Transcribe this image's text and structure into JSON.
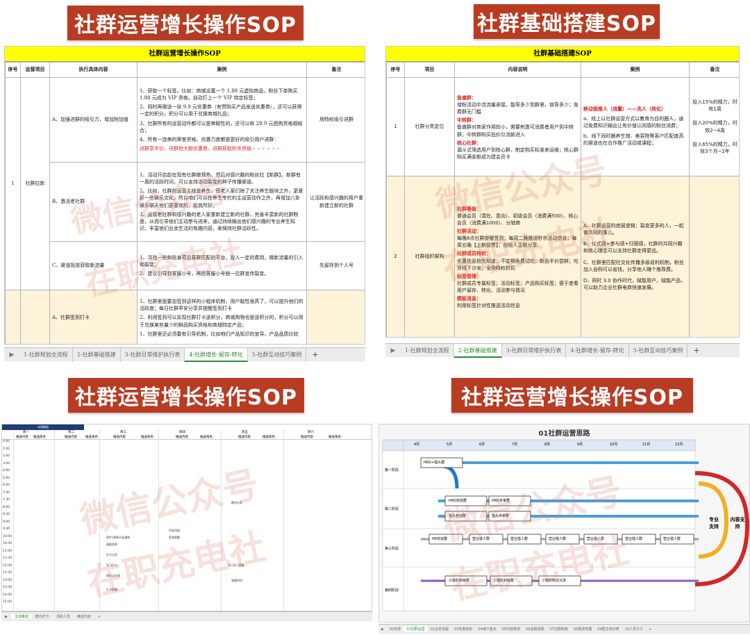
{
  "q1": {
    "banner": "社群运营增长操作SOP",
    "sheet_title": "社群运营增长操作SOP",
    "headers": [
      "序号",
      "运营项目",
      "执行具体内容",
      "案例",
      "备注"
    ],
    "seq": "1",
    "project": "社群拉新",
    "rows": [
      {
        "content": "A、加强进群的吸引力，增加附加值",
        "cases": [
          "1、获取一个标签。比如：商城设置一个 1.88 元虚拟商品，粉丝下单购买1.88 元成为 VIP 资格，自动打上一个 VIP 特定标签；",
          "2、同时再赠送一张 9.9 元优惠券（有赞购买产品发送优惠券），还可以获得一定的积分，积分可以用于兑换商城礼品；",
          "3、社群所有的运营动作都可以是串联性的，还可以和 29.9 元团购资格相结合；",
          "4、所有一连串的荣誉资格、优惠力度都是更好的吸引用户进群："
        ],
        "warn": "进群享半价、进群抢大额优惠券、进群获取秒杀资格・・・・・・",
        "note": "用特权吸引进群"
      },
      {
        "content": "B、激活老社群",
        "cases": [
          "1、活动开启前在现有社群做预热，然后对感兴趣的粉丝拉【新群】，新群有一周的活跃时间，可以支持活动裂变的种子传播渠道。",
          "2、比如，社群的运营主线是养生，而老人家们除了关注养生版块之外，更爱好一些娱乐文化，所以咱们可以在养生专栏的主运营动作之外，再增加八卦娱乐聊天他们更喜欢的，投其所好。",
          "3、运营老社群和感兴趣的老人家重新建立新的社群，完善丰富新的社群制度，从而引导他们主动参与进来，通过持续输出他们感兴趣的专业养生知识、丰富他们业余生活的有趣内容，来保持社群活跃性。"
        ],
        "note": "让活跃和感兴趣的用户重新建立新的社群"
      },
      {
        "content": "C、渠道投放获取新流量",
        "cases": [
          "1、寻找一些和自身项目客群匹配的平台，投入一定的费用，做新流量的引入和裂变；",
          "2、建议引导到客服小号，再由客服小号统一拉群宣传裂变。"
        ],
        "note": "先留存到个人号"
      },
      {
        "content": "A、社群签到打卡",
        "cases": [
          "1、社群里面要加签到这样的小程序机制，用户黏性很高了，可以提升他们的活跃度；每日社群早安分享并提醒签到打卡",
          "2、利用签到可以实现社群打卡送积分，商城购物也是送积分的，积分可以用于兑换某些量少的鲜品购买资格和商城特定产品；",
          "1、社群里还必须要有引导机制，比如咱们产品知识的宣导、产品品质比较"
        ]
      }
    ],
    "tabs": [
      "1-社群规划全流程",
      "2-社群基础搭建",
      "3-社群日常维护执行表",
      "4-社群增长-留存-转化",
      "5-社群互动技巧案例"
    ],
    "active_tab": "4-社群增长-留存-转化"
  },
  "q2": {
    "banner": "社群基础搭建SOP",
    "sheet_title": "社群基础搭建SOP",
    "headers": [
      "序号",
      "项目",
      "内容说明",
      "案例",
      "备注"
    ],
    "row1": {
      "seq": "1",
      "project": "社群分类定位",
      "items": [
        {
          "label": "鱼塘群：",
          "text": "增粉活动中流流量承接，能导多少到群里，就导多少；免费群无门槛"
        },
        {
          "label": "中转群：",
          "text": "鱼塘群对商家作用较小，需要刺激可消费者用户到中转群；中转群购买低价引流款进入"
        },
        {
          "label": "核心社群：",
          "text": "漏斗式筛选用户到核心群，制定购买标准来运维；核心群购买满金额成为建会员卡"
        }
      ],
      "case_title": "移动锁推人（流量）——洗人（转化）",
      "cases": [
        "a、线上以社群运营方式以教育为目的圈人，通过免费知识输出让有价值认同感的粉丝消费；",
        "b、线下同时跟养生馆、美容院等客户匹配度高的渠道也在合作推广活动或课程；"
      ],
      "notes": [
        "投入15%的精力，时效1周",
        "投入20%的精力，时效2~4周",
        "投入65%的精力，时效3个月~2年"
      ]
    },
    "row2": {
      "seq": "2",
      "project": "社群组织架构",
      "items": [
        {
          "label": "社群等级：",
          "text": "普通会员（潜在、意向）、初级会员（消费满500）、核心会员（消费满1000）、分销商"
        },
        {
          "label": "社群活动：",
          "text": "每晚8点社群提醒签到；每周二晚推送秒杀活动信息；每周五晚【上新投票】；创始人主题分享"
        },
        {
          "label": "社群成员特权：",
          "text": "优惠信息抢先知道；不定期免费试吃；新品半价尝鲜；吃货线下沙龙；全场特权折扣"
        },
        {
          "label": "标签管理：",
          "text": "社群成员专属标签；活动标签；产品购买标签；便于查看用户留存、转化、活动参与情况"
        },
        {
          "label": "模板消息：",
          "text": "利用标签针对性推送活动信息"
        }
      ],
      "cases": [
        "A、社群运营的底层逻辑：裂变更多的人，一起做共同的事儿。",
        "B、仪式感+参与感+归宿感，社群的共同兴趣和核心理念可以支持社群走得更远。",
        "C、社群里匹配社交化传播多级返利机制，粉丝加入自购可以省钱，分享他人赚个推荐费。",
        "D、同时 3.0 协作时代，赋能用户，赋能产品，可以助力企业社群电商快速发展。"
      ]
    },
    "tabs": [
      "1-社群规划全流程",
      "2-社群基础搭建",
      "3-社群日常维护执行表",
      "4-社群增长-留存-转化",
      "5-社群互动技巧案例"
    ],
    "active_tab": "2-社群基础搭建"
  },
  "q3": {
    "banner": "社群运营增长操作SOP",
    "header": "本周精选",
    "days": [
      "周一",
      "周二",
      "周三",
      "周四",
      "周五",
      "周六"
    ],
    "col_heads": [
      "推送内容",
      "推送角色"
    ],
    "times": [
      "0:00",
      "1:00",
      "2:00",
      "3:00",
      "4:00",
      "5:00",
      "6:00",
      "7:00",
      "7:30",
      "8:00",
      "8:30",
      "9:00",
      "9:30",
      "10:00",
      "10:30",
      "11:00",
      "11:30",
      "12:00",
      "12:30",
      "13:00",
      "13:30",
      "14:00",
      "15:00"
    ],
    "entries": [
      "DAY1预热开始通知",
      "鼓励签到",
      "早安问候",
      "签到提醒",
      "打卡分享",
      "学习打卡",
      "知识点分享",
      "打卡提醒",
      "今日学习提醒",
      "晚间分享",
      "答疑时间"
    ],
    "tabs": [
      "主动推送",
      "群内打卡",
      "活跃人员",
      "推送内容"
    ],
    "active_tab": "主动推送"
  },
  "q4": {
    "banner": "社群运营增长操作SOP",
    "diagram_title": "01社群运营思路",
    "months": [
      "4月",
      "5月",
      "6月",
      "7月",
      "8月",
      "9月",
      "10月",
      "11月",
      "12月"
    ],
    "phases": [
      "第一阶段",
      "第二阶段",
      "第三阶段",
      "第四阶段"
    ],
    "boxes": [
      "HRD+猎头群",
      "HRD初创群",
      "HRD专家群",
      "猎头初创群",
      "猎头专家群",
      "HR初创群",
      "营业猎人群",
      "小猎豹初级群",
      "小猎豹知识沉淀"
    ],
    "side_labels": [
      "专业支持",
      "内容支持"
    ],
    "tabs": [
      "00目录",
      "01社群运营",
      "02业务流程",
      "03年度目标",
      "04用户盘点",
      "05内容规划",
      "06话题流程",
      "07社群制度",
      "08嘉宾管理",
      "09群主培训表",
      "10人员分工"
    ],
    "active_tab": "01社群运营"
  },
  "watermark": [
    "微信公众号",
    "在职充电社"
  ]
}
